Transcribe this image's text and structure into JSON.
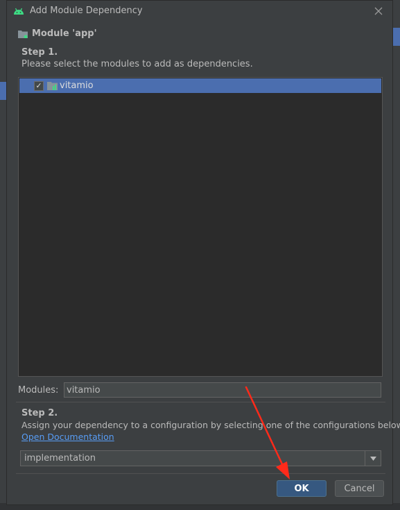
{
  "dialog": {
    "title": "Add Module Dependency",
    "close_icon": "close-icon",
    "title_icon": "android-icon"
  },
  "module": {
    "title": "Module 'app'",
    "icon": "module-folder-icon"
  },
  "step1": {
    "label": "Step 1.",
    "description": "Please select the modules to add as dependencies.",
    "modules": [
      {
        "name": "vitamio",
        "checked": true,
        "selected": true,
        "icon": "module-folder-icon"
      }
    ]
  },
  "modules_field": {
    "label": "Modules:",
    "value": "vitamio"
  },
  "step2": {
    "label": "Step 2.",
    "description": "Assign your dependency to a configuration by selecting one of the configurations below.",
    "link": "Open Documentation",
    "configuration": "implementation",
    "dropdown_icon": "chevron-down-icon"
  },
  "buttons": {
    "ok": "OK",
    "cancel": "Cancel"
  },
  "colors": {
    "background": "#3c3f41",
    "selection": "#4b6eaf",
    "primary_button": "#365880",
    "link": "#589df6",
    "annotation_arrow": "#ff2a1a"
  }
}
